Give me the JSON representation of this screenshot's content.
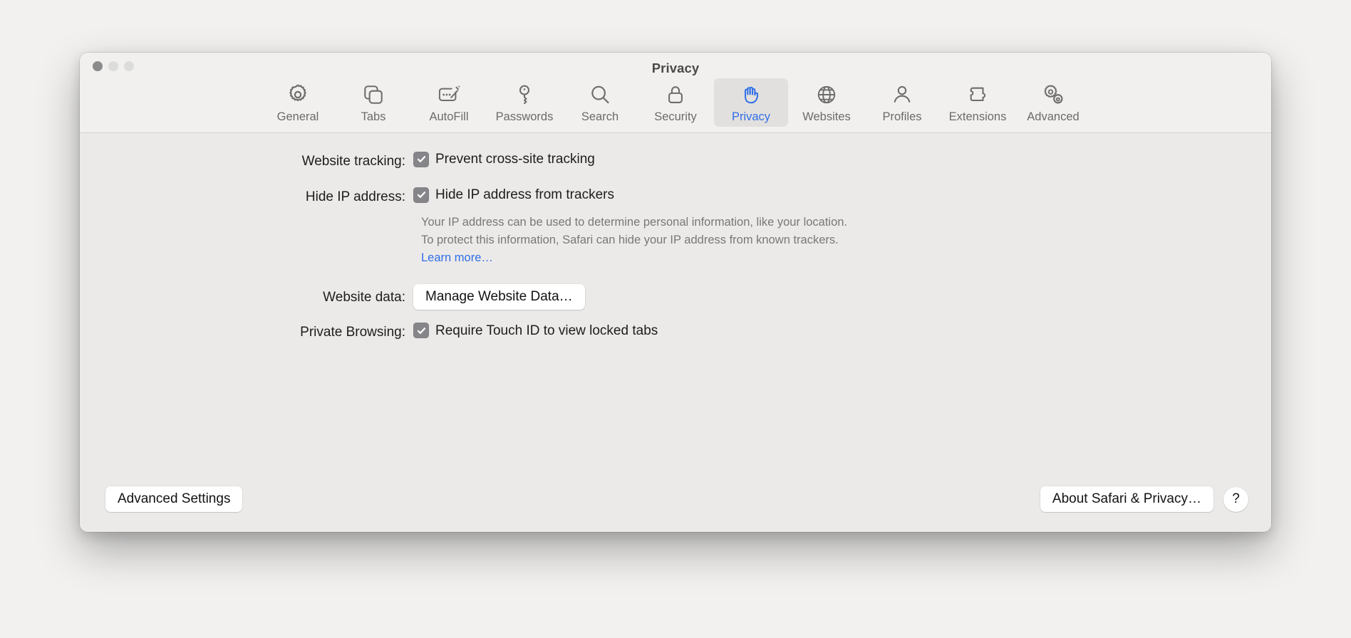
{
  "window": {
    "title": "Privacy",
    "traffic_lights": [
      "close-button",
      "minimize-button",
      "zoom-button"
    ]
  },
  "toolbar": {
    "tabs": [
      {
        "label": "General",
        "icon": "gear-icon",
        "selected": false
      },
      {
        "label": "Tabs",
        "icon": "tabs-icon",
        "selected": false
      },
      {
        "label": "AutoFill",
        "icon": "autofill-icon",
        "selected": false
      },
      {
        "label": "Passwords",
        "icon": "key-icon",
        "selected": false
      },
      {
        "label": "Search",
        "icon": "magnifier-icon",
        "selected": false
      },
      {
        "label": "Security",
        "icon": "lock-icon",
        "selected": false
      },
      {
        "label": "Privacy",
        "icon": "hand-icon",
        "selected": true
      },
      {
        "label": "Websites",
        "icon": "globe-icon",
        "selected": false
      },
      {
        "label": "Profiles",
        "icon": "person-icon",
        "selected": false
      },
      {
        "label": "Extensions",
        "icon": "puzzle-piece-icon",
        "selected": false
      },
      {
        "label": "Advanced",
        "icon": "gears-icon",
        "selected": false
      }
    ]
  },
  "main": {
    "website_tracking": {
      "label": "Website tracking:",
      "checkbox_label": "Prevent cross-site tracking",
      "checked": true
    },
    "hide_ip": {
      "label": "Hide IP address:",
      "checkbox_label": "Hide IP address from trackers",
      "checked": true,
      "helper_text": "Your IP address can be used to determine personal information, like your location. To protect this information, Safari can hide your IP address from known trackers. ",
      "learn_more": "Learn more…"
    },
    "website_data": {
      "label": "Website data:",
      "button_label": "Manage Website Data…"
    },
    "private_browsing": {
      "label": "Private Browsing:",
      "checkbox_label": "Require Touch ID to view locked tabs",
      "checked": true
    }
  },
  "footer": {
    "advanced_settings_label": "Advanced Settings",
    "about_label": "About Safari & Privacy…",
    "help_label": "?"
  },
  "colors": {
    "accent_blue": "#2f6fe8",
    "checkbox_fill": "#86868a",
    "window_bg": "#eceae8",
    "toolbar_bg": "#f2f0ee",
    "desktop_bg": "#f2f1f0"
  }
}
